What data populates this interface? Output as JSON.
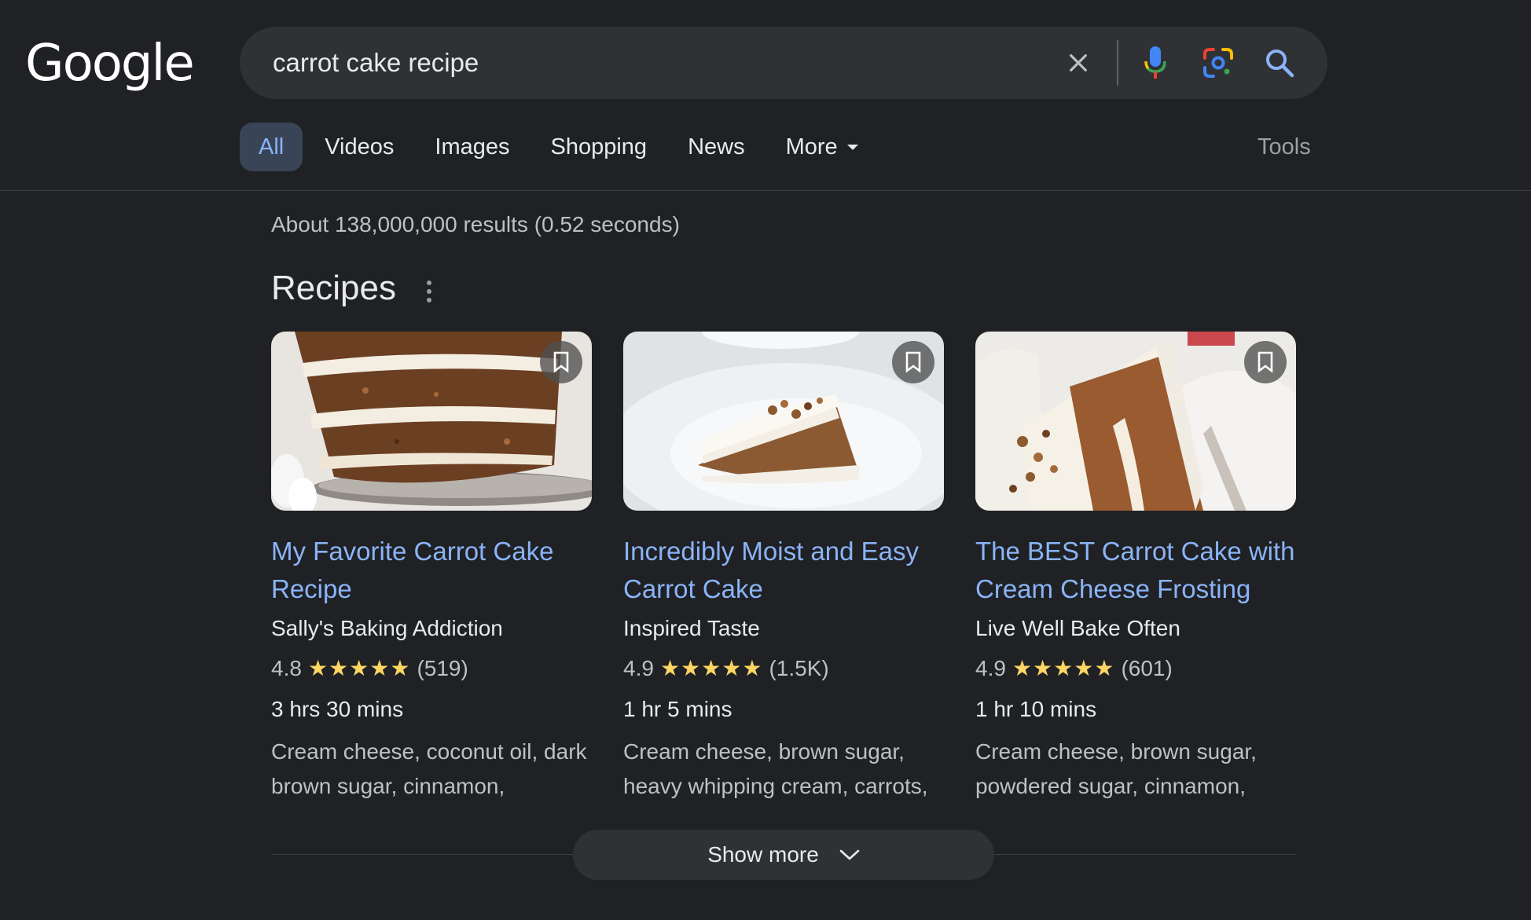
{
  "logo": "Google",
  "search": {
    "query": "carrot cake recipe"
  },
  "tabs": [
    {
      "label": "All",
      "active": true
    },
    {
      "label": "Videos"
    },
    {
      "label": "Images"
    },
    {
      "label": "Shopping"
    },
    {
      "label": "News"
    },
    {
      "label": "More"
    }
  ],
  "tools_label": "Tools",
  "result_stats": "About 138,000,000 results (0.52 seconds)",
  "recipes": {
    "heading": "Recipes",
    "cards": [
      {
        "title": "My Favorite Carrot Cake Recipe",
        "source": "Sally's Baking Addiction",
        "rating": "4.8",
        "stars": "★★★★★",
        "reviews": "(519)",
        "time": "3 hrs 30 mins",
        "ingredients": "Cream cheese, coconut oil, dark brown sugar, cinnamon,"
      },
      {
        "title": "Incredibly Moist and Easy Carrot Cake",
        "source": "Inspired Taste",
        "rating": "4.9",
        "stars": "★★★★★",
        "reviews": "(1.5K)",
        "time": "1 hr 5 mins",
        "ingredients": "Cream cheese, brown sugar, heavy whipping cream, carrots,"
      },
      {
        "title": "The BEST Carrot Cake with Cream Cheese Frosting",
        "source": "Live Well Bake Often",
        "rating": "4.9",
        "stars": "★★★★★",
        "reviews": "(601)",
        "time": "1 hr 10 mins",
        "ingredients": "Cream cheese, brown sugar, powdered sugar, cinnamon,"
      }
    ]
  },
  "show_more_label": "Show more",
  "colors": {
    "background": "#202124",
    "link": "#8ab4f8",
    "star": "#fdd663",
    "active_tab": "#394457"
  }
}
